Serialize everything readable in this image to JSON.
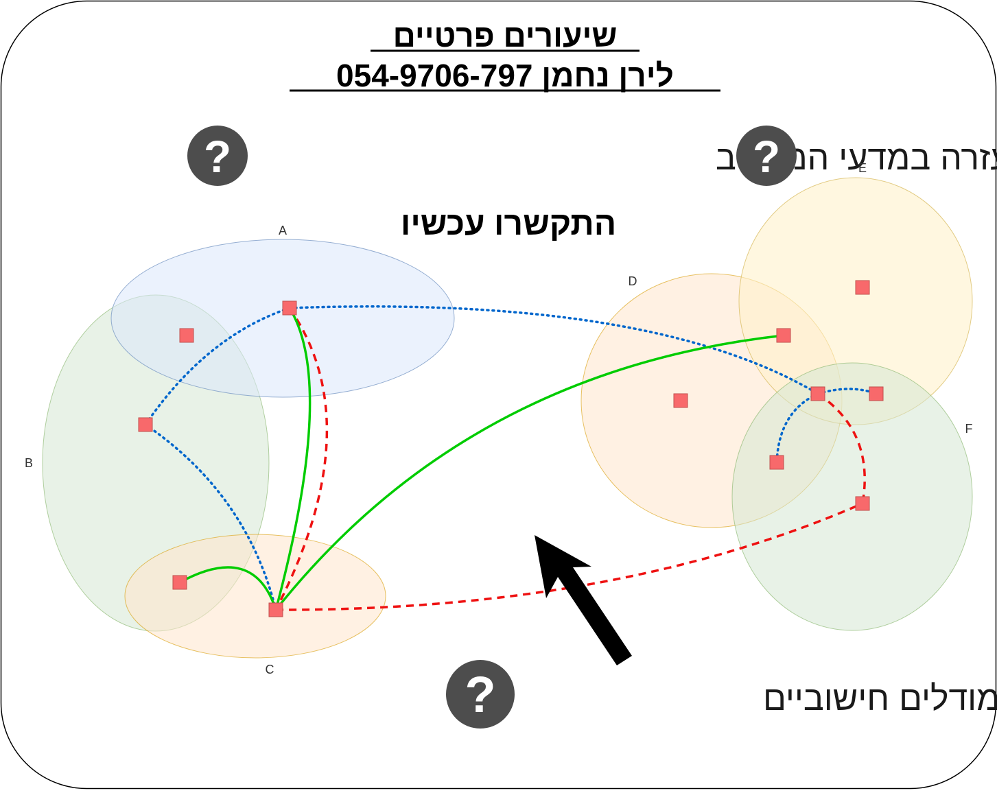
{
  "header": {
    "title_line1": "שיעורים פרטיים",
    "title_line2": "לירן נחמן  054-9706-797",
    "subtitle": "צריכים עזרה במדעי המחשב",
    "cta": "התקשרו עכשיו",
    "footer_text": "מודלים חישוביים"
  },
  "icons": {
    "question_glyph": "?",
    "question_badge": "question-circle-icon",
    "arrow": "arrow-up-left-icon"
  },
  "diagram": {
    "sets": [
      {
        "id": "A",
        "label": "A",
        "fill": "#dae8fc",
        "stroke": "#6c8ebf"
      },
      {
        "id": "B",
        "label": "B",
        "fill": "#d5e8d4",
        "stroke": "#82b366"
      },
      {
        "id": "C",
        "label": "C",
        "fill": "#ffe6cc",
        "stroke": "#d79b00"
      },
      {
        "id": "D",
        "label": "D",
        "fill": "#ffe6cc",
        "stroke": "#d79b00"
      },
      {
        "id": "E",
        "label": "E",
        "fill": "#fff2cc",
        "stroke": "#d6b656"
      },
      {
        "id": "F",
        "label": "F",
        "fill": "#d5e8d4",
        "stroke": "#82b366"
      }
    ],
    "node_color": "#f8696b",
    "edge_colors": {
      "solid": "#00cc00",
      "dotted": "#0066cc",
      "dashed": "#ee1111"
    }
  },
  "colors": {
    "badge": "#4d4d4d",
    "frame": "#000000"
  }
}
